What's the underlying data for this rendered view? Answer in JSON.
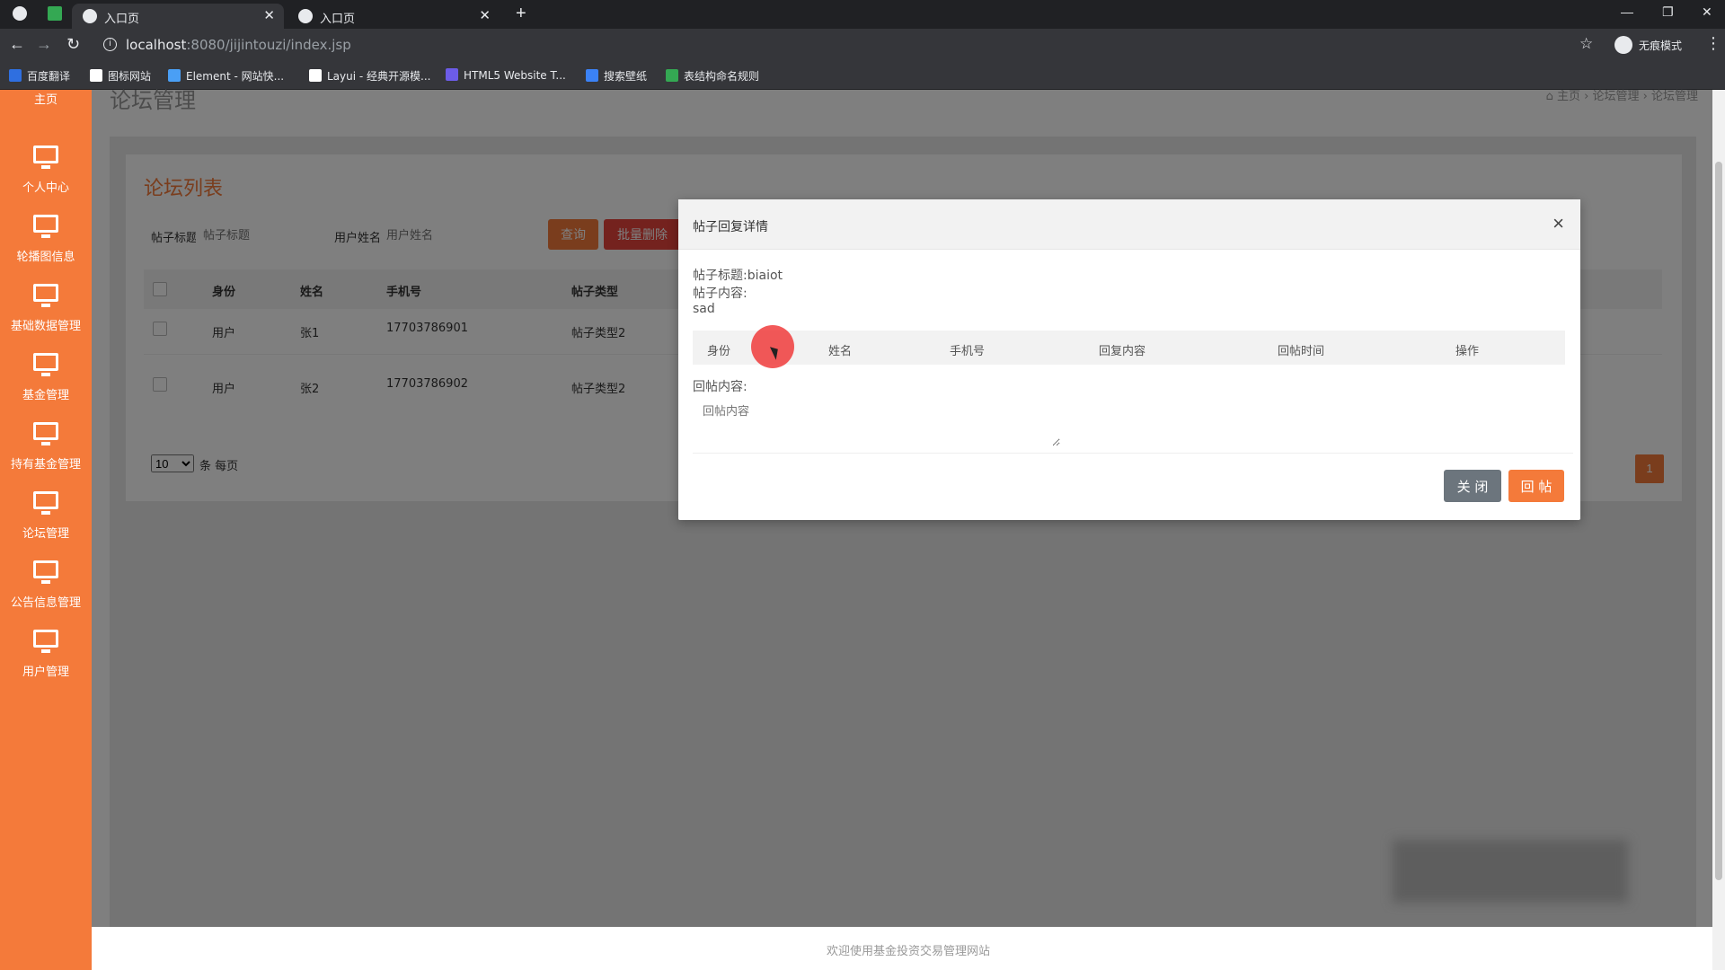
{
  "browser": {
    "tabs": [
      {
        "title": "入口页",
        "active": true
      },
      {
        "title": "入口页",
        "active": false
      }
    ],
    "url_host": "localhost",
    "url_path": ":8080/jijintouzi/index.jsp",
    "incognito_label": "无痕模式",
    "bookmarks": [
      {
        "label": "百度翻译",
        "color": "#2f6fe0"
      },
      {
        "label": "图标网站",
        "color": "#ffffff"
      },
      {
        "label": "Element - 网站快...",
        "color": "#4a9ff5"
      },
      {
        "label": "Layui - 经典开源模...",
        "color": "#ffffff"
      },
      {
        "label": "HTML5 Website T...",
        "color": "#6c5ce7"
      },
      {
        "label": "搜索壁纸",
        "color": "#3b82f6"
      },
      {
        "label": "表结构命名规则",
        "color": "#34a853"
      }
    ]
  },
  "sidebar": {
    "items": [
      {
        "label": "主页"
      },
      {
        "label": "个人中心"
      },
      {
        "label": "轮播图信息"
      },
      {
        "label": "基础数据管理"
      },
      {
        "label": "基金管理"
      },
      {
        "label": "持有基金管理"
      },
      {
        "label": "论坛管理"
      },
      {
        "label": "公告信息管理"
      },
      {
        "label": "用户管理"
      }
    ]
  },
  "page": {
    "title": "论坛管理",
    "breadcrumb": [
      "主页",
      "论坛管理",
      "论坛管理"
    ],
    "card_title": "论坛列表",
    "filters": [
      {
        "label": "帖子标题",
        "placeholder": "帖子标题"
      },
      {
        "label": "用户姓名",
        "placeholder": "用户姓名"
      }
    ],
    "search_button": "查询",
    "batch_delete_button": "批量删除",
    "table": {
      "columns": [
        "身份",
        "姓名",
        "手机号",
        "帖子类型"
      ],
      "rows": [
        [
          "用户",
          "张1",
          "17703786901",
          "帖子类型2"
        ],
        [
          "用户",
          "张2",
          "17703786902",
          "帖子类型2"
        ]
      ]
    },
    "page_size": "10",
    "page_size_suffix": "条 每页",
    "current_page": "1",
    "footer": "欢迎使用基金投资交易管理网站"
  },
  "modal": {
    "title": "帖子回复详情",
    "post_title_line": "帖子标题:biaiot",
    "post_content_label": "帖子内容:",
    "post_content": "sad",
    "reply_columns": [
      "身份",
      "姓名",
      "手机号",
      "回复内容",
      "回帖时间",
      "操作"
    ],
    "reply_content_label": "回帖内容:",
    "reply_placeholder": "回帖内容",
    "close_button": "关 闭",
    "reply_button": "回 帖"
  },
  "colors": {
    "accent": "#f47a3a",
    "danger": "#e8453c",
    "secondary": "#6c757d"
  }
}
